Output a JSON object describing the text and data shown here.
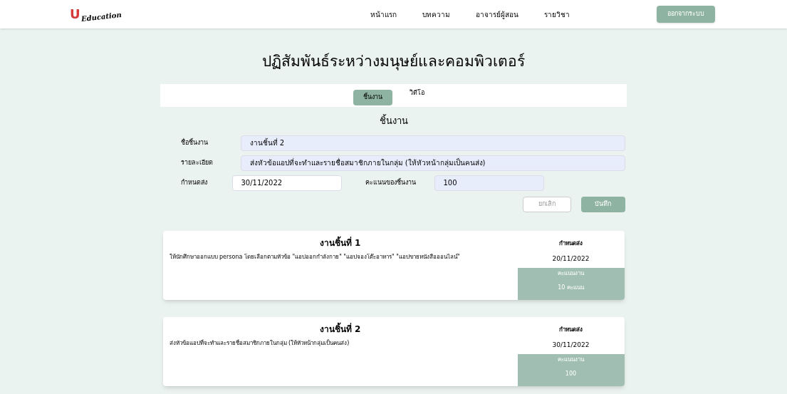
{
  "logo": {
    "mark": "U",
    "text": "Education"
  },
  "nav": [
    {
      "label": "หน้าแรก"
    },
    {
      "label": "บทความ"
    },
    {
      "label": "อาจารย์ผู้สอน"
    },
    {
      "label": "รายวิชา"
    }
  ],
  "logout_button": "ออกจากระบบ",
  "page_title": "ปฏิสัมพันธ์ระหว่างมนุษย์และคอมพิวเตอร์",
  "tabs": [
    {
      "label": "ชิ้นงาน",
      "selected": true
    },
    {
      "label": "วิดีโอ",
      "selected": false
    }
  ],
  "form": {
    "title": "ชิ้นงาน",
    "name": {
      "label": "ชื่อชิ้นงาน",
      "value": "งานชิ้นที่ 2"
    },
    "detail": {
      "label": "รายละเอียด",
      "value": "ส่งหัวข้อแอปที่จะทำและรายชื่อสมาชิกภายในกลุ่ม (ให้หัวหน้ากลุ่มเป็นคนส่ง)"
    },
    "due": {
      "label": "กำหนดส่ง",
      "value": "30/11/2022"
    },
    "score": {
      "label": "คะแนนของชิ้นงาน",
      "value": "100"
    },
    "cancel_button": "ยกเลิก",
    "save_button": "บันทึก"
  },
  "assignments": [
    {
      "title": "งานชิ้นที่ 1",
      "description": "ให้นักศึกษาออกแบบ persona โดยเลือกตามหัวข้อ \"แอปออกกำลังกาย\" \"แอปจองโต๊ะอาหาร\" \"แอปขายหนังสือออนไลน์\"",
      "due_label": "กำหนดส่ง",
      "due": "20/11/2022",
      "score_label": "คะแนนงาน",
      "score": "10 คะแนน"
    },
    {
      "title": "งานชิ้นที่ 2",
      "description": "ส่งหัวข้อแอปที่จะทำและรายชื่อสมาชิกภายในกลุ่ม (ให้หัวหน้ากลุ่มเป็นคนส่ง)",
      "due_label": "กำหนดส่ง",
      "due": "30/11/2022",
      "score_label": "คะแนนงาน",
      "score": "100"
    }
  ]
}
